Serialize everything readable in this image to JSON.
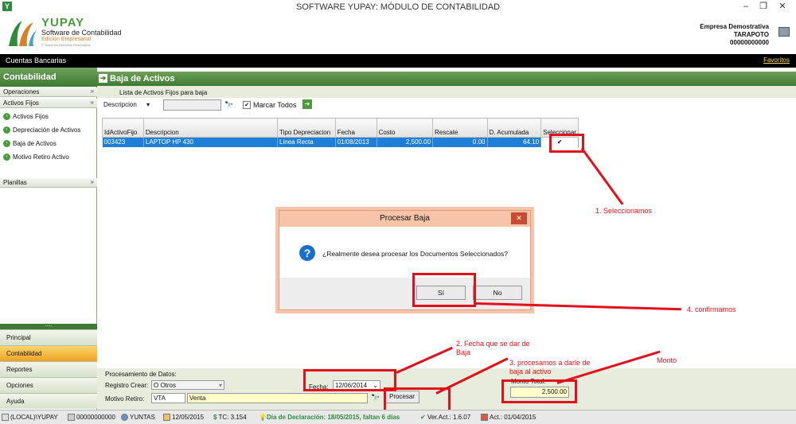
{
  "window": {
    "title": "SOFTWARE YUPAY: MÓDULO DE CONTABILIDAD",
    "app_icon": "Y"
  },
  "brand": {
    "name": "YUPAY",
    "line1": "Software de Contabilidad",
    "line2": "Edición Empresarial",
    "line3": "© Todos los Derechos Reservados"
  },
  "company": {
    "name": "Empresa Demostrativa",
    "city": "TARAPOTO",
    "ruc": "00000000000"
  },
  "topbar": {
    "left": "Cuentas Bancarias",
    "favorites": "Favoritos"
  },
  "sidebar": {
    "header": "Contabilidad",
    "operaciones": "Operaciones",
    "activos_fijos": "Activos Fijos",
    "items": [
      "Activos Fijos",
      "Depreciación de Activos",
      "Baja de Activos",
      "Motivo Retiro Activo"
    ],
    "planillas": "Planillas",
    "nav": [
      "Principal",
      "Contabilidad",
      "Reportes",
      "Opciones",
      "Ayuda"
    ]
  },
  "main": {
    "title": "Baja de Activos",
    "sublabel": "Lista de Activos Fijos para baja",
    "desc_select": "Descripcion",
    "marcar": "Marcar Todos"
  },
  "table": {
    "headers": [
      "IdActivoFijo",
      "Descripcion",
      "Tipo Depreciacion",
      "Fecha",
      "Costo",
      "Rescate",
      "D. Acumulada",
      "Seleccionar"
    ],
    "rows": [
      [
        "003423",
        "LAPTOP HP 430",
        "Linea Recta",
        "01/08/2013",
        "2,500.00",
        "0.00",
        "64.10",
        "✔"
      ]
    ]
  },
  "bottom": {
    "proc_label": "Procesamiento de Datos:",
    "registro_label": "Registro Crear:",
    "registro_value": "O   Otros",
    "motivo_label": "Motivo Retiro:",
    "motivo_code": "VTA",
    "motivo_desc": "Venta",
    "fecha_label": "Fecha:",
    "fecha_value": "12/06/2014",
    "procesar": "Procesar",
    "monto_label": "Monto Total:",
    "monto_value": "2,500.00"
  },
  "dialog": {
    "title": "Procesar Baja",
    "close": "✕",
    "message": "¿Realmente desea procesar los Documentos Seleccionados?",
    "yes": "Sí",
    "no": "No"
  },
  "annotations": {
    "a1": "1. Seleccionamos",
    "a2": "2. Fecha que se dar de Baja",
    "a3": "3. procesamos a darle de baja al activo",
    "a4": "4.  confirmamos",
    "monto": "Monto"
  },
  "status": {
    "server": "(LOCAL)\\YUPAY",
    "ruc": "00000000000",
    "user": "YUNTAS",
    "date": "12/05/2015",
    "tc": "TC: 3.154",
    "declaracion": "Día de Declaración: 18/05/2015, faltan 6 días",
    "version": "Ver.Act.: 1.6.07",
    "act": "Act.: 01/04/2015"
  },
  "colors": {
    "green": "#3e7a33",
    "selection": "#1e7fd8",
    "annotation_red": "#e2101a"
  }
}
